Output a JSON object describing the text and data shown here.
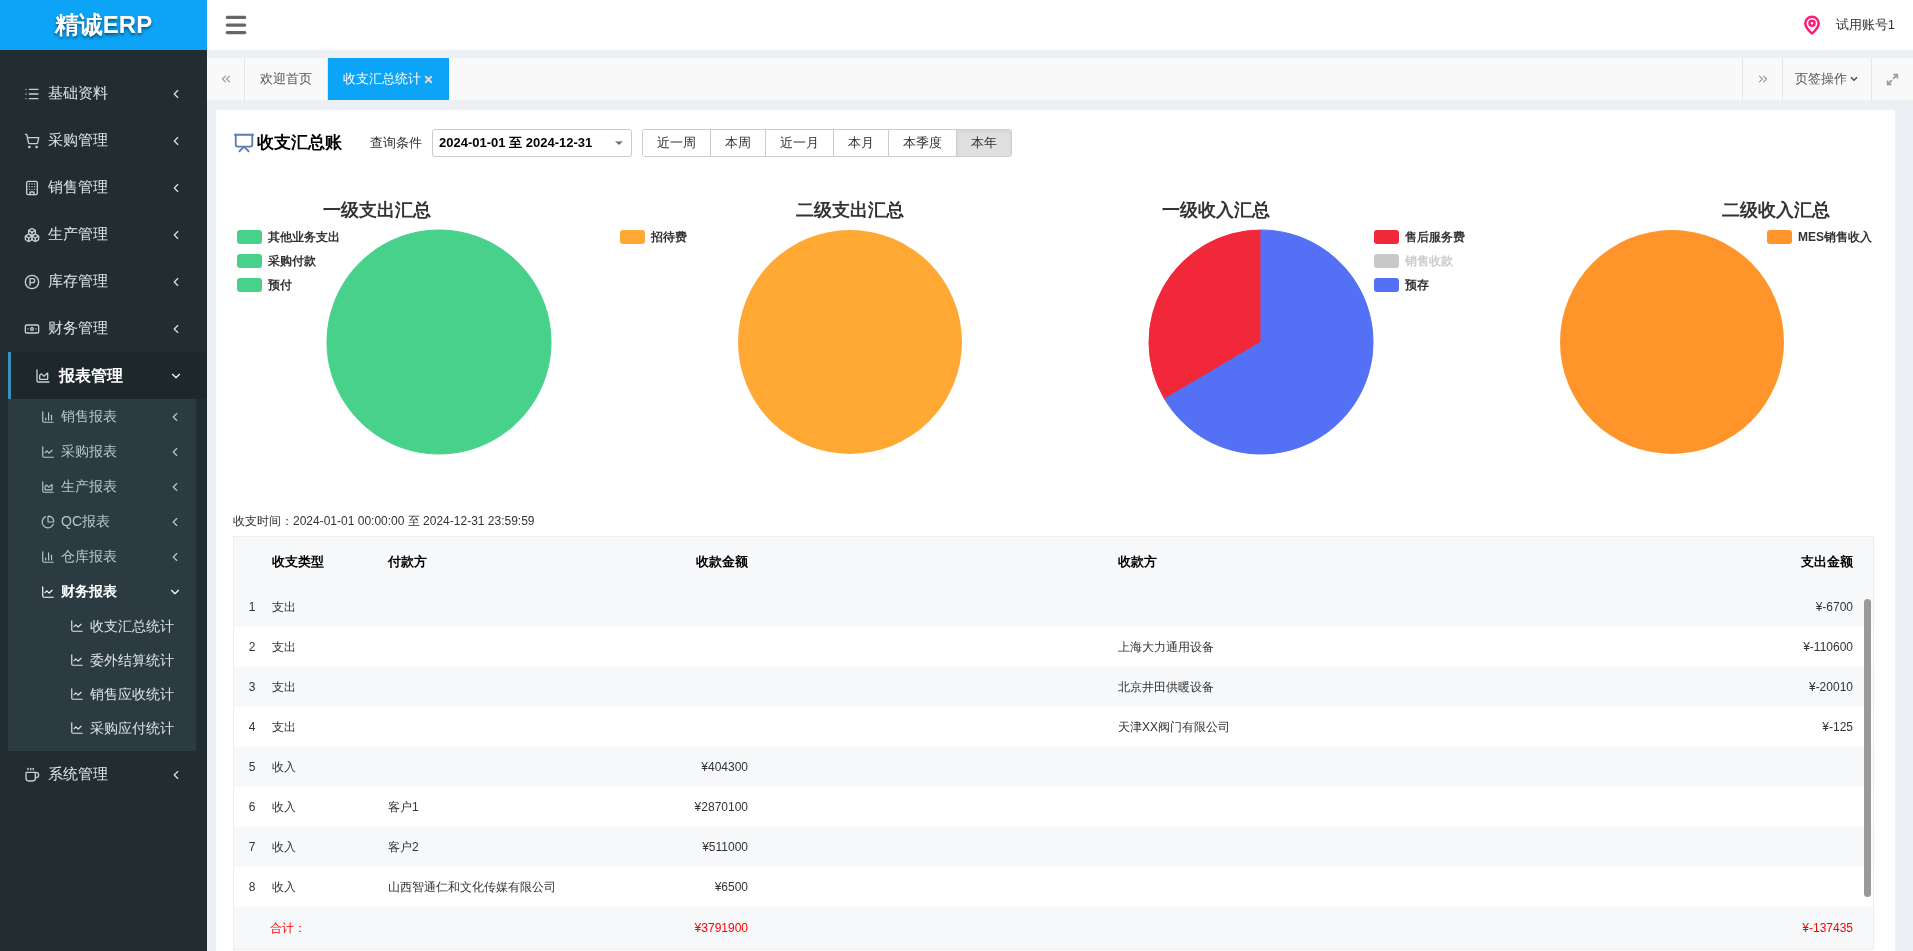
{
  "brand": "精诚ERP",
  "sidebar": {
    "items": [
      {
        "label": "基础资料",
        "expanded": false
      },
      {
        "label": "采购管理",
        "expanded": false
      },
      {
        "label": "销售管理",
        "expanded": false
      },
      {
        "label": "生产管理",
        "expanded": false
      },
      {
        "label": "库存管理",
        "expanded": false
      },
      {
        "label": "财务管理",
        "expanded": false
      },
      {
        "label": "报表管理",
        "expanded": true,
        "children": [
          {
            "label": "销售报表",
            "expanded": false
          },
          {
            "label": "采购报表",
            "expanded": false
          },
          {
            "label": "生产报表",
            "expanded": false
          },
          {
            "label": "QC报表",
            "expanded": false
          },
          {
            "label": "仓库报表",
            "expanded": false
          },
          {
            "label": "财务报表",
            "expanded": true,
            "children": [
              {
                "label": "收支汇总统计"
              },
              {
                "label": "委外结算统计"
              },
              {
                "label": "销售应收统计"
              },
              {
                "label": "采购应付统计"
              }
            ]
          }
        ]
      },
      {
        "label": "系统管理",
        "expanded": false
      }
    ]
  },
  "header": {
    "user": "试用账号1"
  },
  "tabs": [
    {
      "label": "欢迎首页",
      "selected": false,
      "closable": false
    },
    {
      "label": "收支汇总统计",
      "selected": true,
      "closable": true
    }
  ],
  "tab_menu": "页签操作",
  "page": {
    "title": "收支汇总账",
    "query_label": "查询条件",
    "date_range": "2024-01-01 至 2024-12-31",
    "periods": [
      {
        "label": "近一周",
        "selected": false
      },
      {
        "label": "本周",
        "selected": false
      },
      {
        "label": "近一月",
        "selected": false
      },
      {
        "label": "本月",
        "selected": false
      },
      {
        "label": "本季度",
        "selected": false
      },
      {
        "label": "本年",
        "selected": true
      }
    ]
  },
  "charts": [
    {
      "title": "一级支出汇总",
      "legend": [
        {
          "label": "其他业务支出",
          "color": "#48d18a",
          "disabled": false
        },
        {
          "label": "采购付款",
          "color": "#48d18a",
          "disabled": false
        },
        {
          "label": "预付",
          "color": "#48d18a",
          "disabled": false
        }
      ]
    },
    {
      "title": "二级支出汇总",
      "legend": [
        {
          "label": "招待费",
          "color": "#ffa834",
          "disabled": false
        }
      ]
    },
    {
      "title": "一级收入汇总",
      "legend": [
        {
          "label": "售后服务费",
          "color": "#f02839",
          "disabled": false
        },
        {
          "label": "销售收款",
          "color": "#c8c8c8",
          "disabled": true
        },
        {
          "label": "预存",
          "color": "#5470f5",
          "disabled": false
        }
      ]
    },
    {
      "title": "二级收入汇总",
      "legend": [
        {
          "label": "MES销售收入",
          "color": "#ff952a",
          "disabled": false
        }
      ]
    }
  ],
  "time_range": "收支时间：2024-01-01 00:00:00 至 2024-12-31 23:59:59",
  "table": {
    "columns": [
      "收支类型",
      "付款方",
      "收款金额",
      "收款方",
      "支出金额"
    ],
    "rows": [
      {
        "index": "1",
        "type": "支出",
        "amount_out": "¥-6700"
      },
      {
        "index": "2",
        "type": "支出",
        "payee": "上海大力通用设备",
        "amount_out": "¥-110600"
      },
      {
        "index": "3",
        "type": "支出",
        "payee": "北京井田供暖设备",
        "amount_out": "¥-20010"
      },
      {
        "index": "4",
        "type": "支出",
        "payee": "天津XX阀门有限公司",
        "amount_out": "¥-125"
      },
      {
        "index": "5",
        "type": "收入",
        "amount_in": "¥404300"
      },
      {
        "index": "6",
        "type": "收入",
        "payer": "客户1",
        "amount_in": "¥2870100"
      },
      {
        "index": "7",
        "type": "收入",
        "payer": "客户2",
        "amount_in": "¥511000"
      },
      {
        "index": "8",
        "type": "收入",
        "payer": "山西智通仁和文化传媒有限公司",
        "amount_in": "¥6500"
      }
    ],
    "total": {
      "label": "合计：",
      "amount_in": "¥3791900",
      "amount_out": "¥-137435"
    }
  }
}
